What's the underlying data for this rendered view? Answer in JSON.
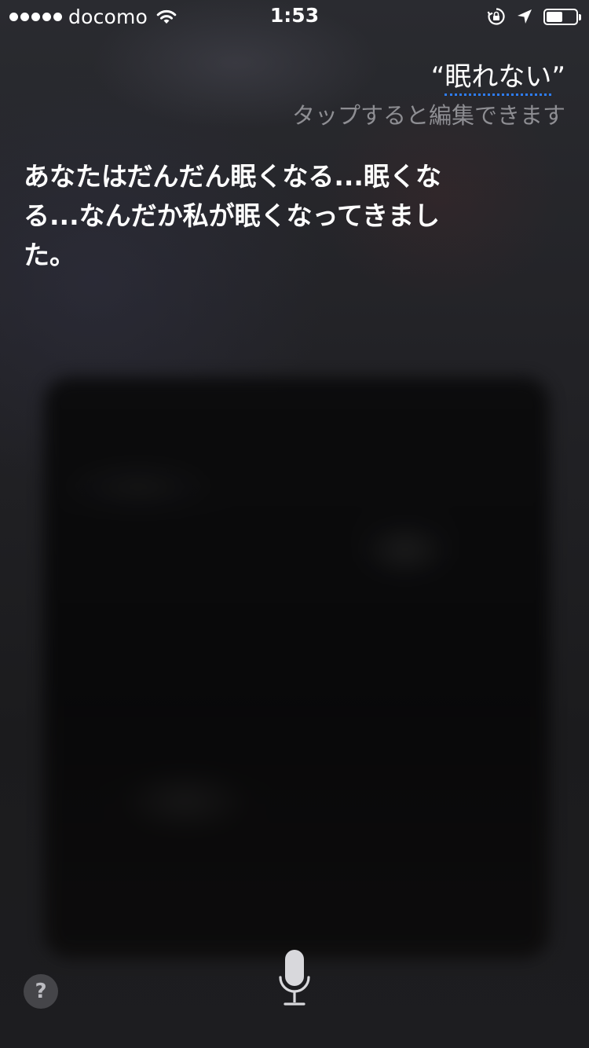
{
  "status_bar": {
    "carrier": "docomo",
    "time": "1:53",
    "signal_bars": 5,
    "battery_level": 0.55,
    "icons": [
      "wifi-icon",
      "rotation-lock-icon",
      "location-arrow-icon",
      "battery-icon"
    ]
  },
  "query": {
    "open_quote": "“",
    "text": "眠れない",
    "close_quote": "”",
    "hint": "タップすると編集できます"
  },
  "response": {
    "text": "あなたはだんだん眠くなる...眠くなる...なんだか私が眠くなってきました。"
  },
  "controls": {
    "help_label": "?",
    "help_icon": "question-icon",
    "mic_icon": "microphone-icon"
  },
  "colors": {
    "accent_underline": "#2e7df6",
    "hint_text": "#8e8e93"
  }
}
